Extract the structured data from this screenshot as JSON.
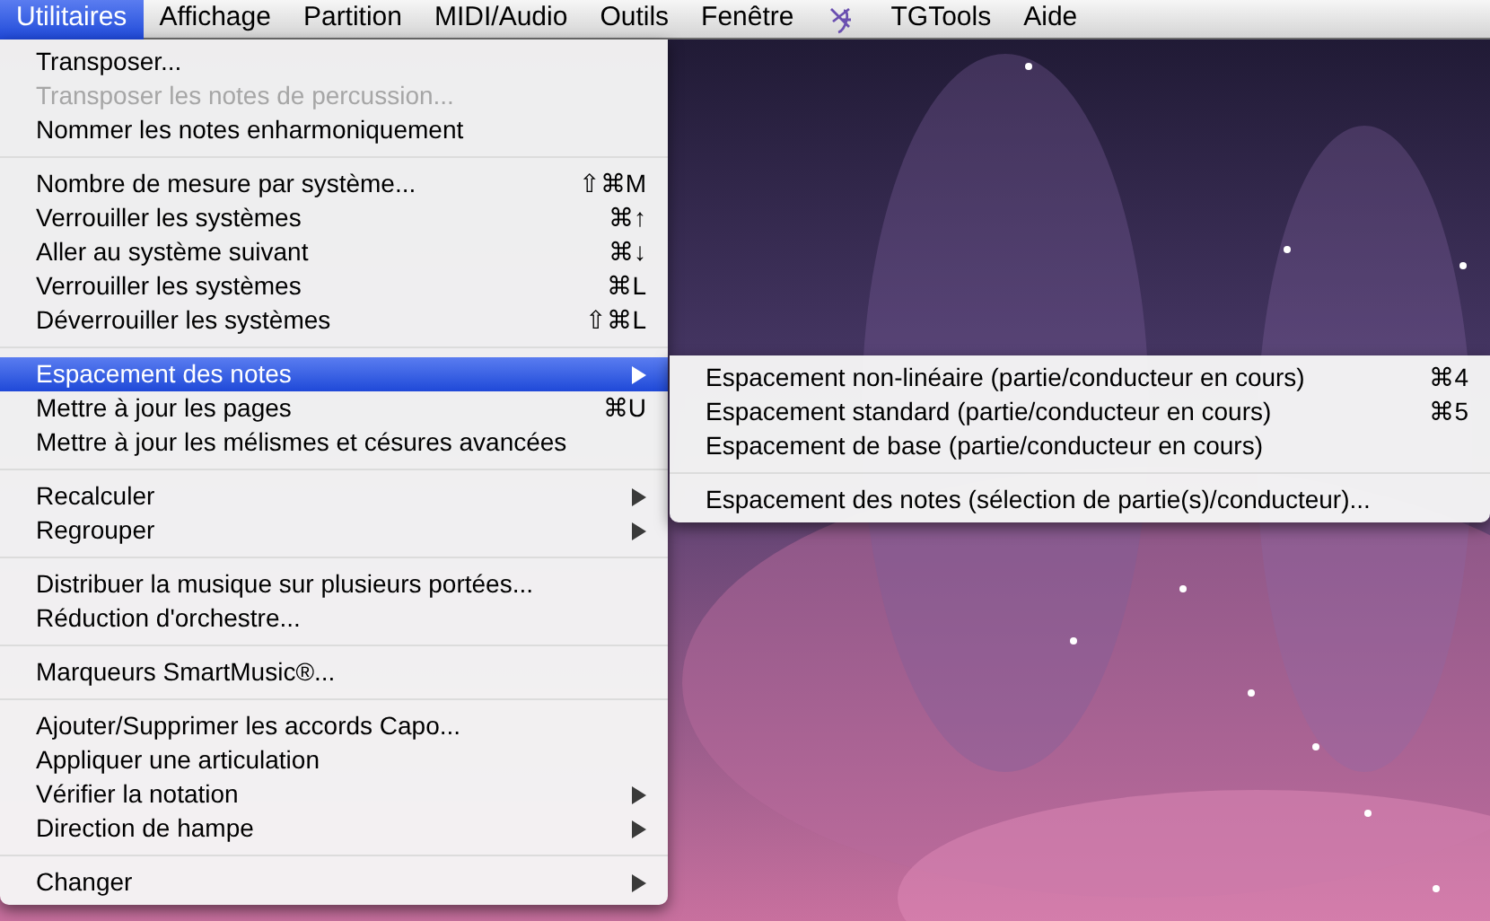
{
  "menubar": [
    {
      "kind": "text",
      "label": "Utilitaires",
      "selected": true
    },
    {
      "kind": "text",
      "label": "Affichage",
      "selected": false
    },
    {
      "kind": "text",
      "label": "Partition",
      "selected": false
    },
    {
      "kind": "text",
      "label": "MIDI/Audio",
      "selected": false
    },
    {
      "kind": "text",
      "label": "Outils",
      "selected": false
    },
    {
      "kind": "text",
      "label": "Fenêtre",
      "selected": false
    },
    {
      "kind": "icon",
      "selected": false
    },
    {
      "kind": "text",
      "label": "TGTools",
      "selected": false
    },
    {
      "kind": "text",
      "label": "Aide",
      "selected": false
    }
  ],
  "menu": {
    "groups": [
      [
        {
          "label": "Transposer...",
          "disabled": false,
          "selected": false,
          "submenu": false
        },
        {
          "label": "Transposer les notes de percussion...",
          "disabled": true,
          "selected": false,
          "submenu": false
        },
        {
          "label": "Nommer les notes enharmoniquement",
          "disabled": false,
          "selected": false,
          "submenu": false
        }
      ],
      [
        {
          "label": "Nombre de mesure par système...",
          "shortcut": "⇧⌘M",
          "disabled": false,
          "selected": false,
          "submenu": false
        },
        {
          "label": "Verrouiller les systèmes",
          "shortcut": "⌘↑",
          "disabled": false,
          "selected": false,
          "submenu": false
        },
        {
          "label": "Aller au système suivant",
          "shortcut": "⌘↓",
          "disabled": false,
          "selected": false,
          "submenu": false
        },
        {
          "label": "Verrouiller les systèmes",
          "shortcut": "⌘L",
          "disabled": false,
          "selected": false,
          "submenu": false
        },
        {
          "label": "Déverrouiller les systèmes",
          "shortcut": "⇧⌘L",
          "disabled": false,
          "selected": false,
          "submenu": false
        }
      ],
      [
        {
          "label": "Espacement des notes",
          "disabled": false,
          "selected": true,
          "submenu": true
        },
        {
          "label": "Mettre à jour les pages",
          "shortcut": "⌘U",
          "disabled": false,
          "selected": false,
          "submenu": false
        },
        {
          "label": "Mettre à jour les mélismes et césures avancées",
          "disabled": false,
          "selected": false,
          "submenu": false
        }
      ],
      [
        {
          "label": "Recalculer",
          "disabled": false,
          "selected": false,
          "submenu": true
        },
        {
          "label": "Regrouper",
          "disabled": false,
          "selected": false,
          "submenu": true
        }
      ],
      [
        {
          "label": "Distribuer la musique sur plusieurs portées...",
          "disabled": false,
          "selected": false,
          "submenu": false
        },
        {
          "label": "Réduction d'orchestre...",
          "disabled": false,
          "selected": false,
          "submenu": false
        }
      ],
      [
        {
          "label": "Marqueurs SmartMusic®...",
          "disabled": false,
          "selected": false,
          "submenu": false
        }
      ],
      [
        {
          "label": "Ajouter/Supprimer les accords Capo...",
          "disabled": false,
          "selected": false,
          "submenu": false
        },
        {
          "label": "Appliquer une articulation",
          "disabled": false,
          "selected": false,
          "submenu": false
        },
        {
          "label": "Vérifier la notation",
          "disabled": false,
          "selected": false,
          "submenu": true
        },
        {
          "label": "Direction de hampe",
          "disabled": false,
          "selected": false,
          "submenu": true
        }
      ],
      [
        {
          "label": "Changer",
          "disabled": false,
          "selected": false,
          "submenu": true
        }
      ]
    ]
  },
  "submenu": {
    "groups": [
      [
        {
          "label": "Espacement non-linéaire (partie/conducteur en cours)",
          "shortcut": "⌘4"
        },
        {
          "label": "Espacement standard (partie/conducteur en cours)",
          "shortcut": "⌘5"
        },
        {
          "label": "Espacement de base (partie/conducteur en cours)"
        }
      ],
      [
        {
          "label": "Espacement des notes (sélection de partie(s)/conducteur)..."
        }
      ]
    ]
  }
}
